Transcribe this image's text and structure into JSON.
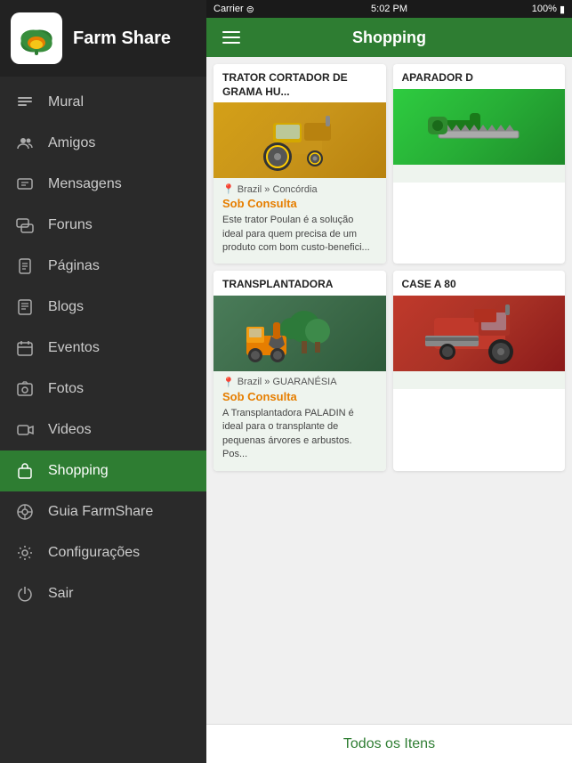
{
  "status_bar": {
    "carrier": "Carrier",
    "time": "5:02 PM",
    "battery": "100%"
  },
  "sidebar": {
    "app_name": "Farm Share",
    "items": [
      {
        "id": "mural",
        "label": "Mural",
        "active": false,
        "icon": "wall-icon"
      },
      {
        "id": "amigos",
        "label": "Amigos",
        "active": false,
        "icon": "people-icon"
      },
      {
        "id": "mensagens",
        "label": "Mensagens",
        "active": false,
        "icon": "message-icon"
      },
      {
        "id": "foruns",
        "label": "Foruns",
        "active": false,
        "icon": "forum-icon"
      },
      {
        "id": "paginas",
        "label": "Páginas",
        "active": false,
        "icon": "pages-icon"
      },
      {
        "id": "blogs",
        "label": "Blogs",
        "active": false,
        "icon": "blog-icon"
      },
      {
        "id": "eventos",
        "label": "Eventos",
        "active": false,
        "icon": "calendar-icon"
      },
      {
        "id": "fotos",
        "label": "Fotos",
        "active": false,
        "icon": "photo-icon"
      },
      {
        "id": "videos",
        "label": "Videos",
        "active": false,
        "icon": "video-icon"
      },
      {
        "id": "shopping",
        "label": "Shopping",
        "active": true,
        "icon": "shopping-icon"
      },
      {
        "id": "guia",
        "label": "Guia FarmShare",
        "active": false,
        "icon": "guide-icon"
      },
      {
        "id": "configuracoes",
        "label": "Configurações",
        "active": false,
        "icon": "settings-icon"
      },
      {
        "id": "sair",
        "label": "Sair",
        "active": false,
        "icon": "power-icon"
      }
    ]
  },
  "top_bar": {
    "title": "Shopping"
  },
  "products": [
    {
      "id": "trator",
      "title": "TRATOR CORTADOR DE GRAMA HU...",
      "location": "Brazil » Concórdia",
      "price": "Sob Consulta",
      "description": "Este trator Poulan é a solução ideal para quem precisa de um produto com bom custo-benefici...",
      "color": "tractor"
    },
    {
      "id": "aparador",
      "title": "Aparador d",
      "location": "",
      "price": "",
      "description": "",
      "color": "aparador"
    },
    {
      "id": "transplantadora",
      "title": "TRANSPLANTADORA",
      "location": "Brazil » GUARANÉSIA",
      "price": "Sob Consulta",
      "description": "A Transplantadora PALADIN é ideal para o transplante de pequenas árvores e arbustos. Pos...",
      "color": "transplantadora"
    },
    {
      "id": "case",
      "title": "CASE A 80",
      "location": "",
      "price": "",
      "description": "",
      "color": "case"
    }
  ],
  "bottom": {
    "link_label": "Todos os Itens"
  }
}
